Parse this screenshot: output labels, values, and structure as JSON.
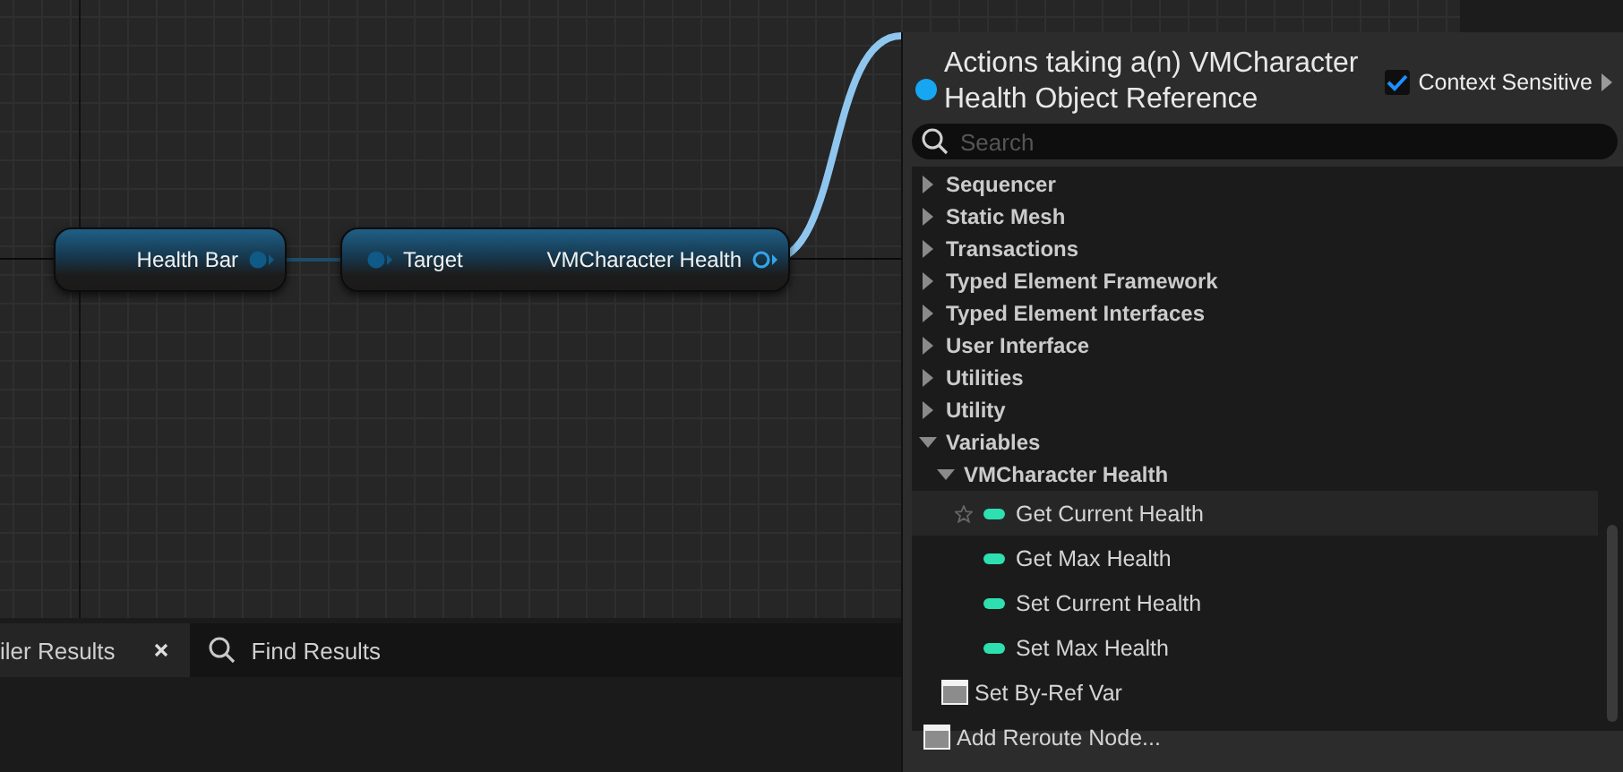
{
  "graph": {
    "nodes": [
      {
        "pins": [
          {
            "label": "Health Bar",
            "kind": "output",
            "connected": true
          }
        ]
      },
      {
        "pins": [
          {
            "label": "Target",
            "kind": "input",
            "connected": true
          },
          {
            "label": "VMCharacter Health",
            "kind": "output",
            "connected": false
          }
        ]
      }
    ]
  },
  "action_menu": {
    "title": "Actions taking a(n) VMCharacter Health Object Reference",
    "context_sensitive": {
      "label": "Context Sensitive",
      "checked": true
    },
    "search": {
      "placeholder": "Search"
    },
    "tree": [
      {
        "kind": "category",
        "label": "Sequencer",
        "expanded": false
      },
      {
        "kind": "category",
        "label": "Static Mesh",
        "expanded": false
      },
      {
        "kind": "category",
        "label": "Transactions",
        "expanded": false
      },
      {
        "kind": "category",
        "label": "Typed Element Framework",
        "expanded": false
      },
      {
        "kind": "category",
        "label": "Typed Element Interfaces",
        "expanded": false
      },
      {
        "kind": "category",
        "label": "User Interface",
        "expanded": false
      },
      {
        "kind": "category",
        "label": "Utilities",
        "expanded": false
      },
      {
        "kind": "category",
        "label": "Utility",
        "expanded": false
      },
      {
        "kind": "category",
        "label": "Variables",
        "expanded": true,
        "children": [
          {
            "kind": "category",
            "label": "VMCharacter Health",
            "expanded": true,
            "children": [
              {
                "kind": "variable",
                "label": "Get Current Health",
                "selected": true
              },
              {
                "kind": "variable",
                "label": "Get Max Health",
                "selected": false
              },
              {
                "kind": "variable",
                "label": "Set Current Health",
                "selected": false
              },
              {
                "kind": "variable",
                "label": "Set Max Health",
                "selected": false
              }
            ]
          },
          {
            "kind": "node",
            "label": "Set By-Ref Var",
            "selected": false
          }
        ]
      },
      {
        "kind": "node",
        "label": "Add Reroute Node...",
        "selected": false
      }
    ]
  },
  "bottom_tabs": [
    {
      "label": "iler Results",
      "selected": true,
      "closable": true
    },
    {
      "label": "Find Results",
      "selected": false,
      "closable": false
    }
  ]
}
